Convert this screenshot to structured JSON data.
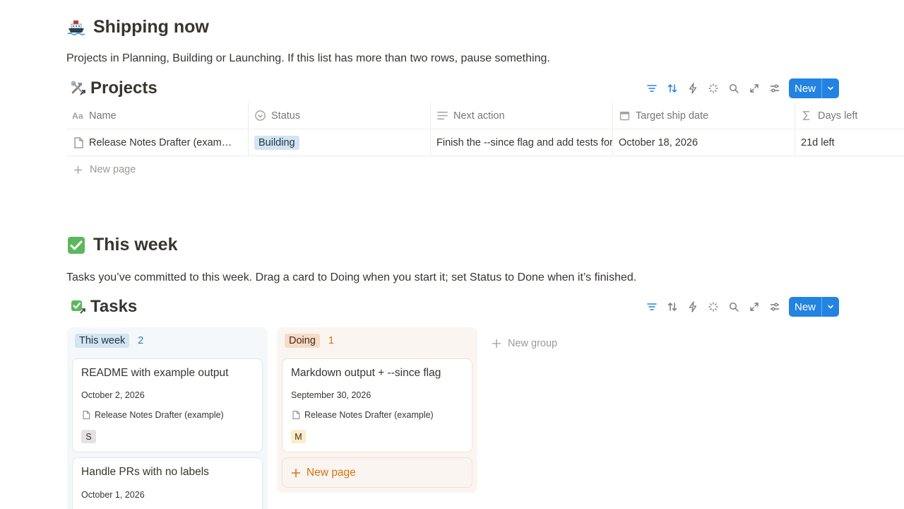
{
  "shipping": {
    "title": "Shipping now",
    "emoji": "ship-icon",
    "description": "Projects in Planning, Building or Launching. If this list has more than two rows, pause something."
  },
  "projects": {
    "title": "Projects",
    "new_label": "New",
    "columns": [
      "Name",
      "Status",
      "Next action",
      "Target ship date",
      "Days left"
    ],
    "rows": [
      {
        "name": "Release Notes Drafter (exam…",
        "status": "Building",
        "next_action": "Finish the --since flag and add tests for",
        "target_ship_date": "October 18, 2026",
        "days_left": "21d left"
      }
    ],
    "new_page": "New page"
  },
  "thisweek": {
    "title": "This week",
    "description": "Tasks you’ve committed to this week. Drag a card to Doing when you start it; set Status to Done when it’s finished."
  },
  "tasks": {
    "title": "Tasks",
    "new_label": "New",
    "groups": [
      {
        "name": "This week",
        "count": "2",
        "cards": [
          {
            "title": "README with example output",
            "date": "October 2, 2026",
            "project": "Release Notes Drafter (example)",
            "size": "S"
          },
          {
            "title": "Handle PRs with no labels",
            "date": "October 1, 2026"
          }
        ]
      },
      {
        "name": "Doing",
        "count": "1",
        "cards": [
          {
            "title": "Markdown output + --since flag",
            "date": "September 30, 2026",
            "project": "Release Notes Drafter (example)",
            "size": "M"
          }
        ],
        "new_page": "New page"
      }
    ],
    "new_group": "New group"
  },
  "colors": {
    "accent": "#2383e2",
    "text": "#37352f",
    "muted": "#787774",
    "blue_tag_bg": "#d3e5ef",
    "orange_tag_bg": "#f5dcc8"
  }
}
